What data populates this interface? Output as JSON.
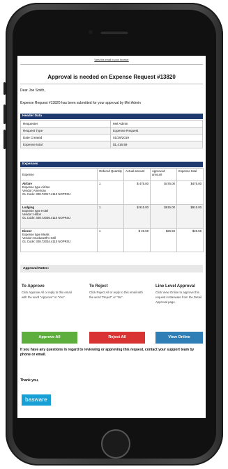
{
  "email": {
    "view_in_browser": "View this email in your browser",
    "title": "Approval is needed on Expense Request #13820",
    "greeting": "Dear Joe Smith,",
    "intro": "Expense Request #13820 has been submitted for your approval by Mel Admin"
  },
  "header_data": {
    "section_label": "Header Data",
    "rows": [
      {
        "label": "Requester",
        "value": "Mel Admin"
      },
      {
        "label": "Request Type",
        "value": "Expense Request"
      },
      {
        "label": "Date Created",
        "value": "01/29/2019"
      },
      {
        "label": "Expense total",
        "value": "$1,416.59"
      }
    ]
  },
  "expenses": {
    "section_label": "Expenses",
    "columns": [
      "Expense",
      "Ordered Quantity",
      "Actual amount",
      "Approved amount",
      "Expense total"
    ],
    "rows": [
      {
        "name": "Airfare",
        "type": "Expense type Airfare",
        "vendor": "Vendor: American",
        "gl": "GL Code: 308.72017.4110 NOPROJ",
        "qty": "1",
        "actual": "$ 475.00",
        "approved": "$475.00",
        "total": "$475.00"
      },
      {
        "name": "Lodging",
        "type": "Expense type Hotel",
        "vendor": "Vendor: Hilton",
        "gl": "GL Code: 308.72036.4110 NOPROJ",
        "qty": "1",
        "actual": "$ 915.00",
        "approved": "$915.00",
        "total": "$915.00"
      },
      {
        "name": "Dinner",
        "type": "Expense type Meals",
        "vendor": "Vendor: Duckworth's Grill",
        "gl": "GL Code: 308.72034.4110 NOPROJ",
        "qty": "1",
        "actual": "$ 26.59",
        "approved": "$26.59",
        "total": "$26.59"
      }
    ]
  },
  "approval_notes_label": "Approval Notes:",
  "instructions": {
    "approve": {
      "heading": "To Approve",
      "body": "Click Approve All or reply to this email with the word \"Approve\" or \"Yes\"."
    },
    "reject": {
      "heading": "To Reject",
      "body": "Click Reject All or reply to this email with the word \"Reject\" or \"No\"."
    },
    "line_level": {
      "heading": "Line Level Approval",
      "body": "Click View Online to approve this request in Basware from the Detail Approval page."
    }
  },
  "buttons": {
    "approve_all": "Approve All",
    "reject_all": "Reject All",
    "view_online": "View Online"
  },
  "colors": {
    "approve": "#5eae3d",
    "reject": "#d93333",
    "view_online": "#2f7fb6",
    "section_header": "#1f3a6e",
    "brand": "#17a0d6"
  },
  "footer": {
    "questions": "If you have any questions in regard to reviewing or approving this request, contact your support team by phone or email.",
    "thanks": "Thank you,",
    "brand_logo_text": "basware"
  }
}
